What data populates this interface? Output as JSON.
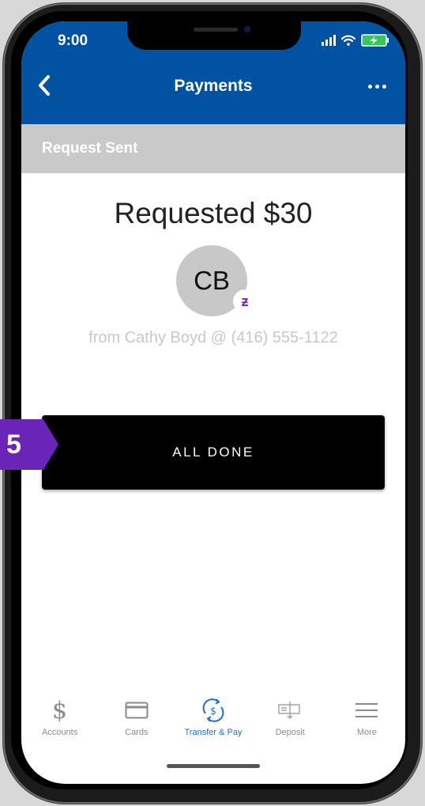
{
  "status_bar": {
    "time": "9:00"
  },
  "nav": {
    "title": "Payments"
  },
  "subheader": {
    "text": "Request Sent"
  },
  "summary": {
    "headline": "Requested $30",
    "avatar_initials": "CB",
    "badge_glyph": "ƶ",
    "from_text": "from Cathy Boyd @ (416) 555-1122"
  },
  "actions": {
    "done_label": "ALL DONE"
  },
  "annotation": {
    "step_number": "5"
  },
  "tabs": [
    {
      "label": "Accounts",
      "icon": "dollar-icon"
    },
    {
      "label": "Cards",
      "icon": "card-icon"
    },
    {
      "label": "Transfer & Pay",
      "icon": "transfer-pay-icon",
      "active": true
    },
    {
      "label": "Deposit",
      "icon": "deposit-icon"
    },
    {
      "label": "More",
      "icon": "menu-icon"
    }
  ],
  "colors": {
    "header_blue": "#0152a2",
    "subheader_gray": "#c9c9c9",
    "accent_purple": "#6a25b8",
    "tab_active": "#1d6fd0"
  }
}
